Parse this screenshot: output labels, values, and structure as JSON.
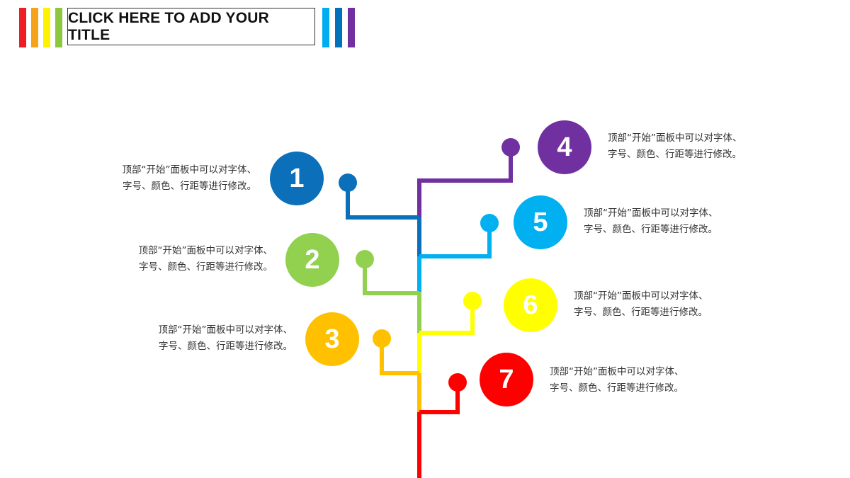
{
  "header": {
    "title": "CLICK HERE TO ADD YOUR TITLE",
    "left_stripes": [
      "#ee1c25",
      "#f5a31a",
      "#fff200",
      "#8dc63f"
    ],
    "right_stripes": [
      "#00aeef",
      "#0072bc",
      "#7030a0"
    ]
  },
  "items": [
    {
      "number": "1",
      "color": "#0b6fba",
      "line1": "顶部“开始”面板中可以对字体、",
      "line2": "字号、颜色、行距等进行修改。"
    },
    {
      "number": "2",
      "color": "#92d050",
      "line1": "顶部“开始”面板中可以对字体、",
      "line2": "字号、颜色、行距等进行修改。"
    },
    {
      "number": "3",
      "color": "#ffc000",
      "line1": "顶部“开始”面板中可以对字体、",
      "line2": "字号、颜色、行距等进行修改。"
    },
    {
      "number": "4",
      "color": "#7030a0",
      "line1": "顶部“开始”面板中可以对字体、",
      "line2": "字号、颜色、行距等进行修改。"
    },
    {
      "number": "5",
      "color": "#00b0f0",
      "line1": "顶部“开始”面板中可以对字体、",
      "line2": "字号、颜色、行距等进行修改。"
    },
    {
      "number": "6",
      "color": "#ffff00",
      "line1": "顶部“开始”面板中可以对字体、",
      "line2": "字号、颜色、行距等进行修改。"
    },
    {
      "number": "7",
      "color": "#ff0000",
      "line1": "顶部“开始”面板中可以对字体、",
      "line2": "字号、颜色、行距等进行修改。"
    }
  ]
}
